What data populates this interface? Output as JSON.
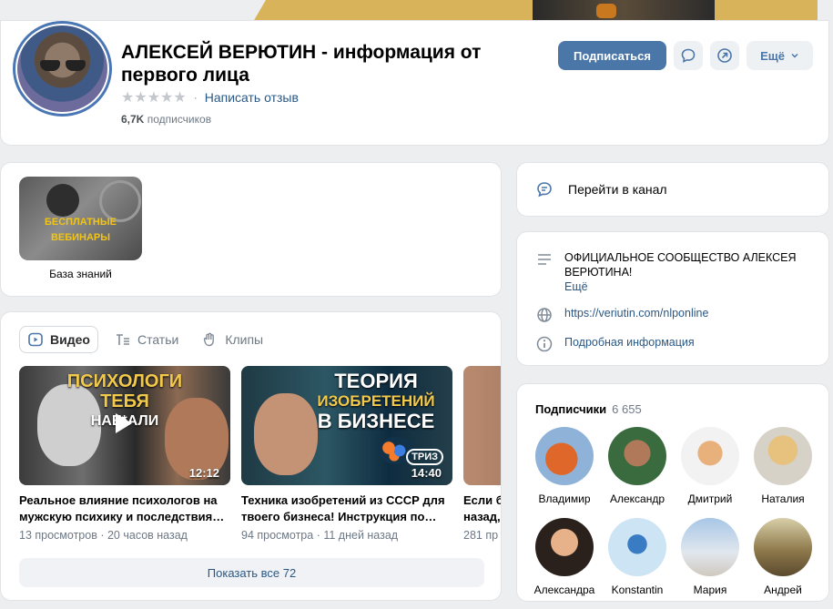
{
  "header": {
    "title": "АЛЕКСЕЙ ВЕРЮТИН - информация от первого лица",
    "rating_stars": "★★★★★",
    "rating_separator": "·",
    "write_review": "Написать отзыв",
    "subscribers_count": "6,7K",
    "subscribers_label": "подписчиков",
    "subscribe_button": "Подписаться",
    "more_button": "Ещё"
  },
  "knowledge": {
    "thumb_text_line1": "БЕСПЛАТНЫЕ",
    "thumb_text_line2": "ВЕБИНАРЫ",
    "label": "База знаний"
  },
  "videos": {
    "tabs": [
      {
        "label": "Видео"
      },
      {
        "label": "Статьи"
      },
      {
        "label": "Клипы"
      }
    ],
    "items": [
      {
        "thumb_line1": "ПСИХОЛОГИ",
        "thumb_line2": "ТЕБЯ",
        "thumb_line3": "НАЕ*АЛИ",
        "duration": "12:12",
        "title_line1": "Реальное влияние психологов на",
        "title_line2": "мужскую психику и последствия…",
        "views": "13 просмотров",
        "age": "20 часов назад"
      },
      {
        "thumb_line1": "ТЕОРИЯ",
        "thumb_line2": "ИЗОБРЕТЕНИЙ",
        "thumb_line3": "В БИЗНЕСЕ",
        "badge": "ТРИЗ",
        "duration": "14:40",
        "title_line1": "Техника изобретений из СССР для",
        "title_line2": "твоего бизнеса! Инструкция по…",
        "views": "94 просмотра",
        "age": "11 дней назад"
      },
      {
        "title_line1": "Если б",
        "title_line2": "назад,",
        "views": "281 пр"
      }
    ],
    "meta_separator": "·",
    "show_all": "Показать все 72"
  },
  "sidebar": {
    "channel_link": "Перейти в канал",
    "info": {
      "description_line1": "ОФИЦИАЛЬНОЕ СООБЩЕСТВО АЛЕКСЕЯ",
      "description_line2": "ВЕРЮТИНА!",
      "description_more": "Ещё",
      "website": "https://veriutin.com/nlponline",
      "details": "Подробная информация"
    },
    "subscribers": {
      "title": "Подписчики",
      "count": "6 655",
      "people": [
        {
          "name": "Владимир"
        },
        {
          "name": "Александр"
        },
        {
          "name": "Дмитрий"
        },
        {
          "name": "Наталия"
        },
        {
          "name": "Александра"
        },
        {
          "name": "Konstantin"
        },
        {
          "name": "Мария"
        },
        {
          "name": "Андрей"
        }
      ]
    }
  },
  "colors": {
    "accent": "#4a76a8",
    "link": "#2a5885",
    "page_bg": "#edeef0",
    "cover_gold": "#d9b35a"
  }
}
